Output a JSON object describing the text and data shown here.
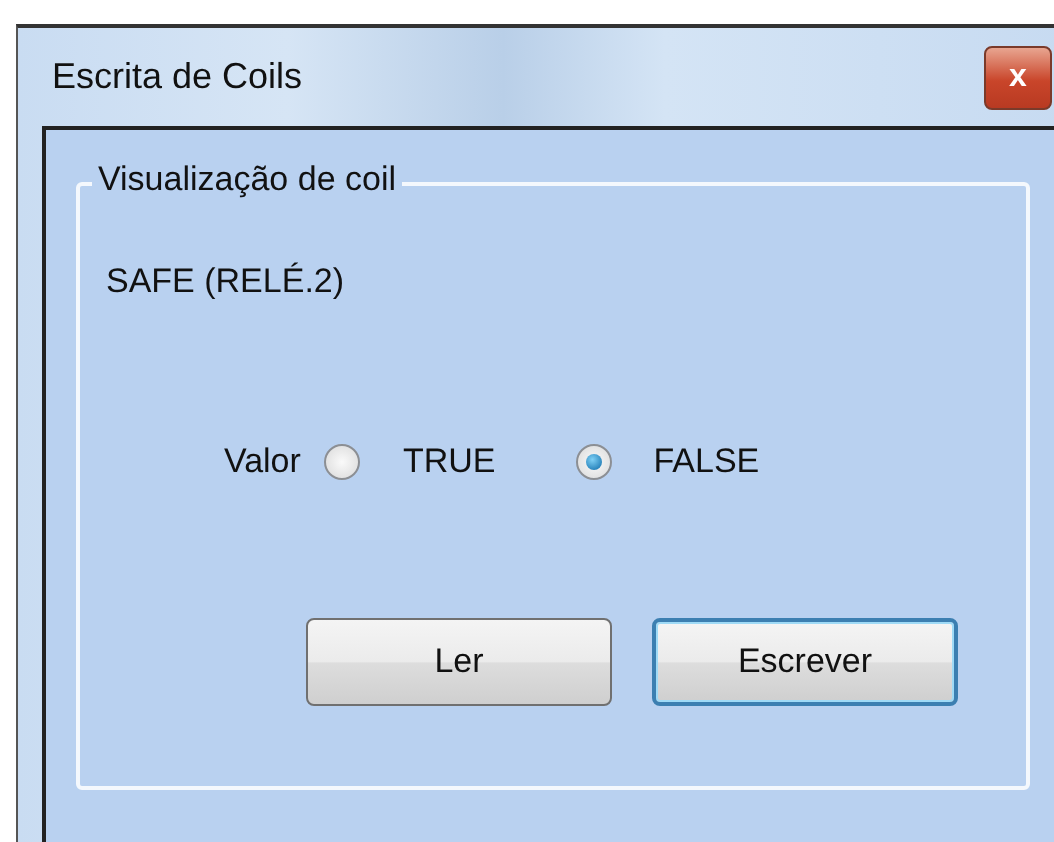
{
  "window": {
    "title": "Escrita de Coils",
    "close_button": "x"
  },
  "group": {
    "title": "Visualização de coil",
    "coil_name": "SAFE (RELÉ.2)",
    "value_label": "Valor",
    "options": [
      {
        "label": "TRUE",
        "selected": false
      },
      {
        "label": "FALSE",
        "selected": true
      }
    ]
  },
  "buttons": [
    {
      "label": "Ler",
      "default": false
    },
    {
      "label": "Escrever",
      "default": true
    }
  ]
}
